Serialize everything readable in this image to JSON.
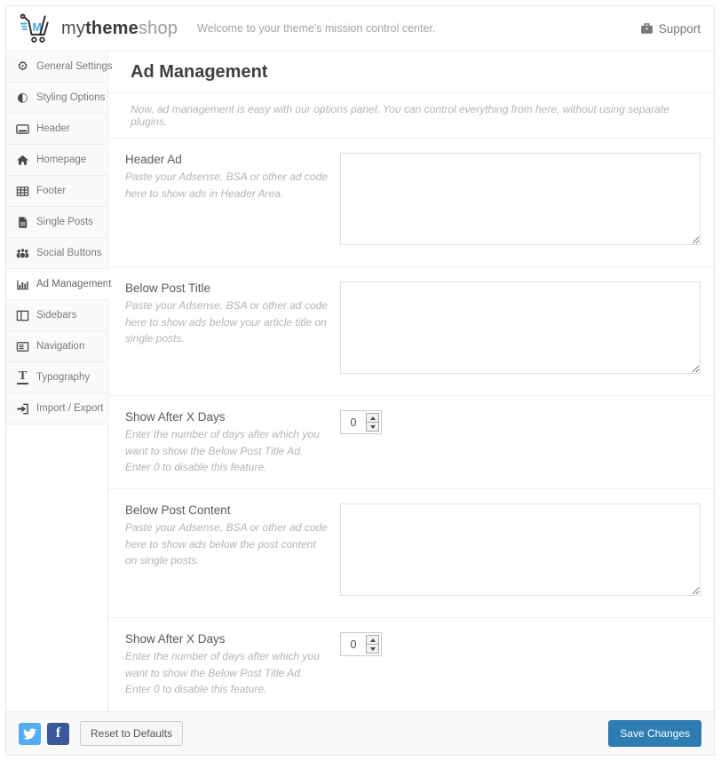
{
  "header": {
    "logo": {
      "my": "my",
      "theme": "theme",
      "shop": "shop"
    },
    "welcome": "Welcome to your theme's mission control center.",
    "support_label": "Support"
  },
  "sidebar": {
    "items": [
      {
        "label": "General Settings",
        "icon": "gears-icon",
        "active": false
      },
      {
        "label": "Styling Options",
        "icon": "contrast-icon",
        "active": false
      },
      {
        "label": "Header",
        "icon": "header-panel-icon",
        "active": false
      },
      {
        "label": "Homepage",
        "icon": "home-icon",
        "active": false
      },
      {
        "label": "Footer",
        "icon": "table-icon",
        "active": false
      },
      {
        "label": "Single Posts",
        "icon": "file-icon",
        "active": false
      },
      {
        "label": "Social Buttons",
        "icon": "users-icon",
        "active": false
      },
      {
        "label": "Ad Management",
        "icon": "bar-chart-icon",
        "active": true
      },
      {
        "label": "Sidebars",
        "icon": "columns-icon",
        "active": false
      },
      {
        "label": "Navigation",
        "icon": "nav-list-icon",
        "active": false
      },
      {
        "label": "Typography",
        "icon": "text-icon",
        "active": false
      },
      {
        "label": "Import / Export",
        "icon": "sign-in-icon",
        "active": false
      }
    ]
  },
  "main": {
    "title": "Ad Management",
    "description": "Now, ad management is easy with our options panel. You can control everything from here, without using separate plugins.",
    "fields": [
      {
        "type": "textarea",
        "label": "Header Ad",
        "description": "Paste your Adsense, BSA or other ad code here to show ads in Header Area.",
        "value": ""
      },
      {
        "type": "textarea",
        "label": "Below Post Title",
        "description": "Paste your Adsense, BSA or other ad code here to show ads below your article title on single posts.",
        "value": ""
      },
      {
        "type": "number",
        "label": "Show After X Days",
        "description": "Enter the number of days after which you want to show the Below Post Title Ad. Enter 0 to disable this feature.",
        "value": "0"
      },
      {
        "type": "textarea",
        "label": "Below Post Content",
        "description": "Paste your Adsense, BSA or other ad code here to show ads below the post content on single posts.",
        "value": ""
      },
      {
        "type": "number",
        "label": "Show After X Days",
        "description": "Enter the number of days after which you want to show the Below Post Title Ad. Enter 0 to disable this feature.",
        "value": "0"
      }
    ]
  },
  "footer": {
    "reset_label": "Reset to Defaults",
    "save_label": "Save Changes"
  },
  "colors": {
    "accent_blue": "#2d7db3",
    "twitter_blue": "#55acee",
    "facebook_blue": "#3b5998",
    "logo_blue": "#4aa8e0"
  }
}
